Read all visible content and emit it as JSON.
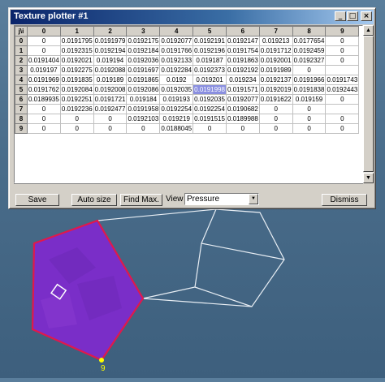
{
  "window": {
    "title": "Texture plotter #1",
    "controls": {
      "minimize": "_",
      "maximize": "□",
      "close": "×"
    }
  },
  "grid": {
    "corner": "j\\i",
    "columns": [
      "0",
      "1",
      "2",
      "3",
      "4",
      "5",
      "6",
      "7",
      "8",
      "9"
    ],
    "rows": [
      {
        "label": "0",
        "cells": [
          "0",
          "0.0191795",
          "0.0191979",
          "0.0192175",
          "0.0192077",
          "0.0192191",
          "0.0192147",
          "0.019213",
          "0.0177654",
          "0"
        ]
      },
      {
        "label": "1",
        "cells": [
          "0",
          "0.0192315",
          "0.0192194",
          "0.0192184",
          "0.0191766",
          "0.0192196",
          "0.0191754",
          "0.0191712",
          "0.0192459",
          "0"
        ]
      },
      {
        "label": "2",
        "cells": [
          "0.0191404",
          "0.0192021",
          "0.019194",
          "0.0192036",
          "0.0192133",
          "0.019187",
          "0.0191863",
          "0.0192001",
          "0.0192327",
          "0"
        ]
      },
      {
        "label": "3",
        "cells": [
          "0.019197",
          "0.0192275",
          "0.0192088",
          "0.0191697",
          "0.0192284",
          "0.0192373",
          "0.0192192",
          "0.0191989",
          "0",
          ""
        ]
      },
      {
        "label": "4",
        "cells": [
          "0.0191969",
          "0.0191835",
          "0.019189",
          "0.0191865",
          "0.0192",
          "0.019201",
          "0.019234",
          "0.0192137",
          "0.0191966",
          "0.0191743"
        ]
      },
      {
        "label": "5",
        "cells": [
          "0.0191762",
          "0.0192084",
          "0.0192008",
          "0.0192086",
          "0.0192035",
          "0.0191998",
          "0.0191571",
          "0.0192019",
          "0.0191838",
          "0.0192443"
        ]
      },
      {
        "label": "6",
        "cells": [
          "0.0189935",
          "0.0192251",
          "0.0191721",
          "0.019184",
          "0.019193",
          "0.0192035",
          "0.0192077",
          "0.0191622",
          "0.019159",
          "0"
        ]
      },
      {
        "label": "7",
        "cells": [
          "0",
          "0.0192236",
          "0.0192477",
          "0.0191958",
          "0.0192254",
          "0.0192254",
          "0.0190682",
          "0",
          "0",
          ""
        ]
      },
      {
        "label": "8",
        "cells": [
          "0",
          "0",
          "0",
          "0.0192103",
          "0.019219",
          "0.0191515",
          "0.0189988",
          "0",
          "0",
          "0"
        ]
      },
      {
        "label": "9",
        "cells": [
          "0",
          "0",
          "0",
          "0",
          "0.0188045",
          "0",
          "0",
          "0",
          "0",
          "0"
        ]
      }
    ],
    "selected": {
      "row": 5,
      "col": 5
    }
  },
  "toolbar": {
    "save_label": "Save",
    "autosize_label": "Auto size",
    "findmax_label": "Find Max.",
    "view_label": "View",
    "view_value": "Pressure",
    "dismiss_label": "Dismiss"
  },
  "viewport": {
    "vertex_label": "9",
    "colors": {
      "background": "#4a6d8b",
      "face_fill": "#7a2ec8",
      "face_edge": "#e0194b",
      "wireframe": "#e8eef4",
      "vertex_marker": "#ffff00"
    }
  }
}
